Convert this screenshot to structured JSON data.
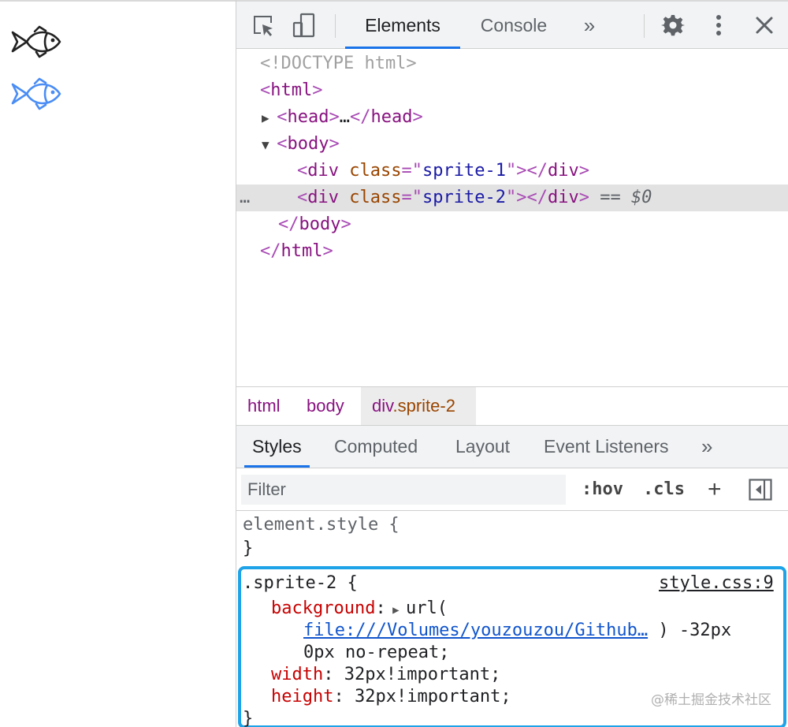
{
  "devtools": {
    "tabs": [
      "Elements",
      "Console"
    ],
    "more_tabs_glyph": "»",
    "icons": {
      "inspect": "inspect-element-icon",
      "device": "device-toggle-icon",
      "settings": "gear-icon",
      "menu": "kebab-menu-icon",
      "close": "close-icon"
    }
  },
  "dom_tree": {
    "doctype": "<!DOCTYPE html>",
    "html_open": "html",
    "head": "head",
    "head_ellipsis": "…",
    "body": "body",
    "div_tag": "div",
    "class_attr": "class",
    "sprite1": "sprite-1",
    "sprite2": "sprite-2",
    "selected_marker": "== $0",
    "row_dots": "…"
  },
  "breadcrumb": [
    "html",
    "body",
    "div",
    ".sprite-2"
  ],
  "styles_tabs": [
    "Styles",
    "Computed",
    "Layout",
    "Event Listeners",
    "»"
  ],
  "filter": {
    "placeholder": "Filter",
    "hov": ":hov",
    "cls": ".cls",
    "plus": "+"
  },
  "rules": {
    "element_style_selector": "element.style {",
    "close_brace": "}",
    "sprite2_selector": ".sprite-2 {",
    "source": "style.css:9",
    "background_prop": "background",
    "background_url_open": "url(",
    "background_url": "file:///Volumes/youzouzou/Github…",
    "background_rest1": ") -32px",
    "background_rest2": "0px no-repeat;",
    "width_prop": "width",
    "width_val": "32px!important;",
    "height_prop": "height",
    "height_val": "32px!important;"
  },
  "watermark": "@稀土掘金技术社区",
  "colors": {
    "accent": "#1a73e8",
    "highlight_border": "#1ea3e8",
    "fish_default": "#222222",
    "fish_hover": "#4a8df5"
  }
}
